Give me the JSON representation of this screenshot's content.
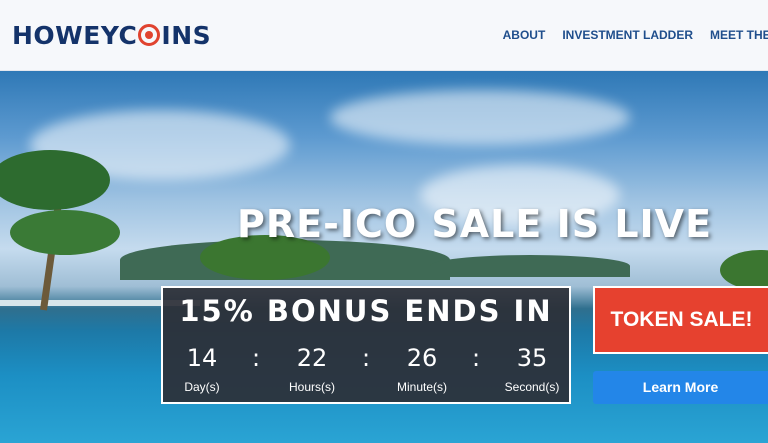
{
  "header": {
    "logo": {
      "before": "HOWEYC",
      "after": "INS",
      "colors": {
        "text": "#14336a",
        "coin": "#e0432f"
      }
    },
    "nav": [
      {
        "label": "ABOUT"
      },
      {
        "label": "INVESTMENT LADDER"
      },
      {
        "label": "MEET THE TEA"
      }
    ]
  },
  "hero": {
    "headline": "PRE-ICO SALE IS LIVE",
    "countdown": {
      "title": "15% BONUS ENDS IN",
      "units": [
        {
          "value": "14",
          "label": "Day(s)"
        },
        {
          "value": "22",
          "label": "Hours(s)"
        },
        {
          "value": "26",
          "label": "Minute(s)"
        },
        {
          "value": "35",
          "label": "Second(s)"
        }
      ],
      "separator": ":"
    },
    "token_sale_label": "TOKEN SALE!",
    "learn_more_label": "Learn More",
    "colors": {
      "token_sale": "#e6412f",
      "learn_more": "#2386e8",
      "countdown_bg": "#2c2f36"
    }
  }
}
